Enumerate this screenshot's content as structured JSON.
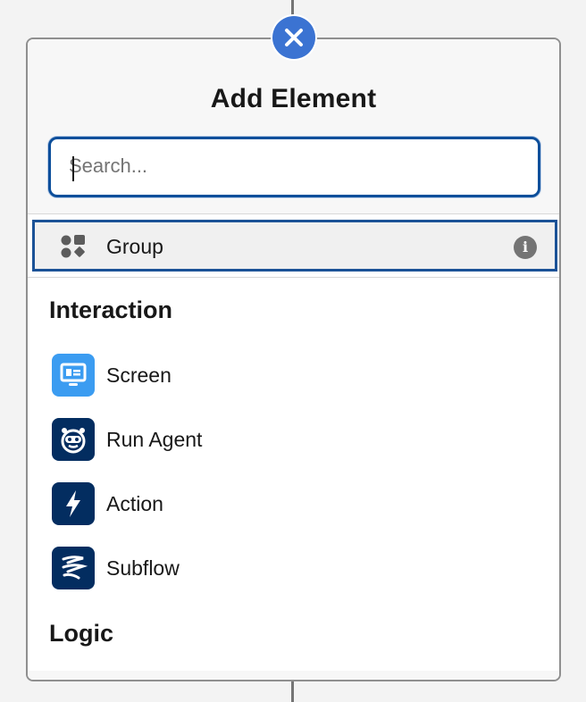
{
  "dialog": {
    "title": "Add Element",
    "close_icon": "close-icon"
  },
  "search": {
    "placeholder": "Search...",
    "value": ""
  },
  "group_item": {
    "label": "Group",
    "icon": "group-shapes-icon",
    "info_icon": "info-icon"
  },
  "sections": [
    {
      "heading": "Interaction",
      "items": [
        {
          "label": "Screen",
          "icon": "screen-icon",
          "color": "#3b9cf1"
        },
        {
          "label": "Run Agent",
          "icon": "agent-icon",
          "color": "#032d60"
        },
        {
          "label": "Action",
          "icon": "lightning-icon",
          "color": "#032d60"
        },
        {
          "label": "Subflow",
          "icon": "subflow-icon",
          "color": "#032d60"
        }
      ]
    },
    {
      "heading": "Logic",
      "items": []
    }
  ],
  "colors": {
    "accent": "#3b73d2",
    "focus_border": "#1b5297",
    "info": "#747474"
  }
}
